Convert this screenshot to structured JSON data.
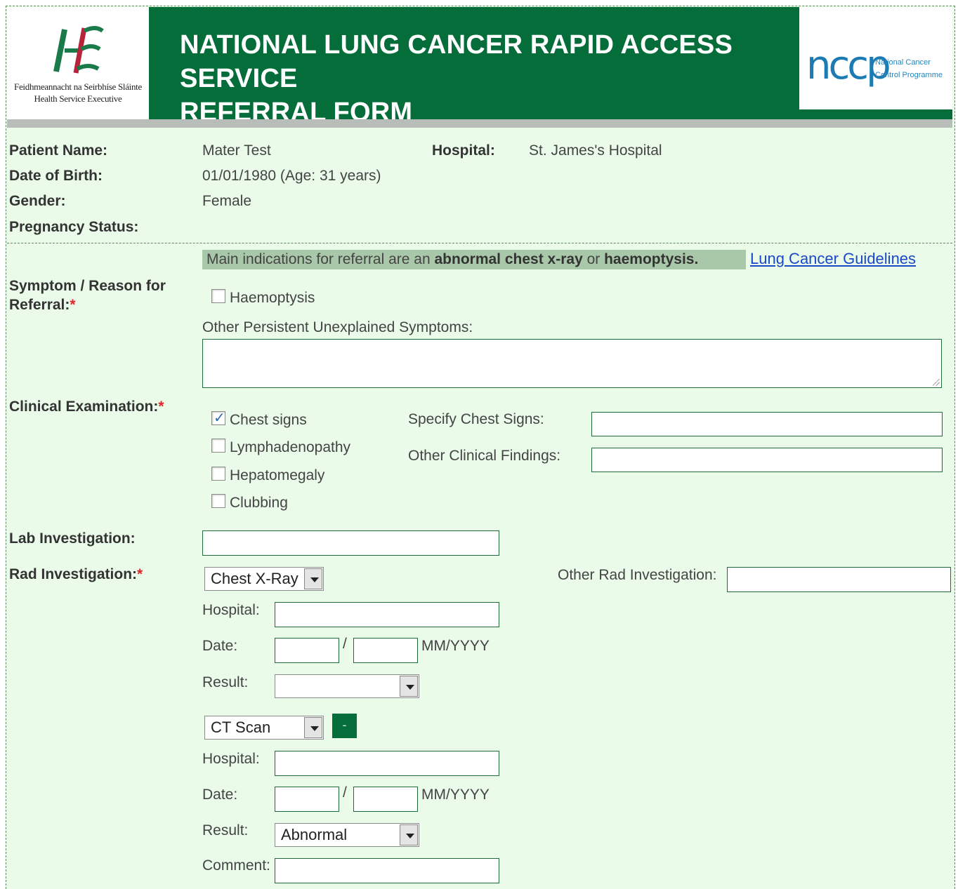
{
  "header": {
    "title_line1": "NATIONAL LUNG CANCER RAPID ACCESS SERVICE",
    "title_line2": "REFERRAL FORM",
    "hse_text_line1": "Feidhmeannacht na Seirbhíse Sláinte",
    "hse_text_line2": "Health Service Executive",
    "ncp_mark": "nccp",
    "ncp_small_line1": "National Cancer",
    "ncp_small_line2": "Control Programme",
    "brand_green": "#046d3a",
    "icons": [
      "hse-logo-icon",
      "nccp-logo-icon"
    ]
  },
  "patient": {
    "name_label": "Patient Name:",
    "name_value": "Mater Test",
    "hospital_label": "Hospital:",
    "hospital_value": "St. James's Hospital",
    "dob_label": "Date of Birth:",
    "dob_value": "01/01/1980 (Age: 31 years)",
    "gender_label": "Gender:",
    "gender_value": "Female",
    "pregnancy_label": "Pregnancy Status:"
  },
  "referral": {
    "note_prefix": "Main indications for referral are an ",
    "note_bold1": "abnormal chest x-ray",
    "note_mid": " or ",
    "note_bold2": "haemoptysis.",
    "guidelines_link": "Lung Cancer Guidelines",
    "symptom_label_line1": "Symptom / Reason for",
    "symptom_label_line2": "Referral:",
    "required_mark": "*",
    "haemoptysis_label": "Haemoptysis",
    "other_symptoms_label": "Other Persistent Unexplained Symptoms:"
  },
  "clinical": {
    "label": "Clinical Examination:",
    "chest_signs": "Chest signs",
    "lymphadenopathy": "Lymphadenopathy",
    "hepatomegaly": "Hepatomegaly",
    "clubbing": "Clubbing",
    "specify_chest_signs_label": "Specify Chest Signs:",
    "other_findings_label": "Other Clinical Findings:"
  },
  "lab": {
    "label": "Lab Investigation:"
  },
  "rad": {
    "label": "Rad Investigation:",
    "other_label": "Other Rad Investigation:",
    "block1": {
      "type": "Chest X-Ray",
      "hospital_label": "Hospital:",
      "date_label": "Date:",
      "date_sep": "/",
      "date_format": "MM/YYYY",
      "result_label": "Result:",
      "result_value": ""
    },
    "block2": {
      "type": "CT Scan",
      "remove_label": "-",
      "hospital_label": "Hospital:",
      "date_label": "Date:",
      "date_sep": "/",
      "date_format": "MM/YYYY",
      "result_label": "Result:",
      "result_value": "Abnormal",
      "comment_label": "Comment:"
    }
  }
}
